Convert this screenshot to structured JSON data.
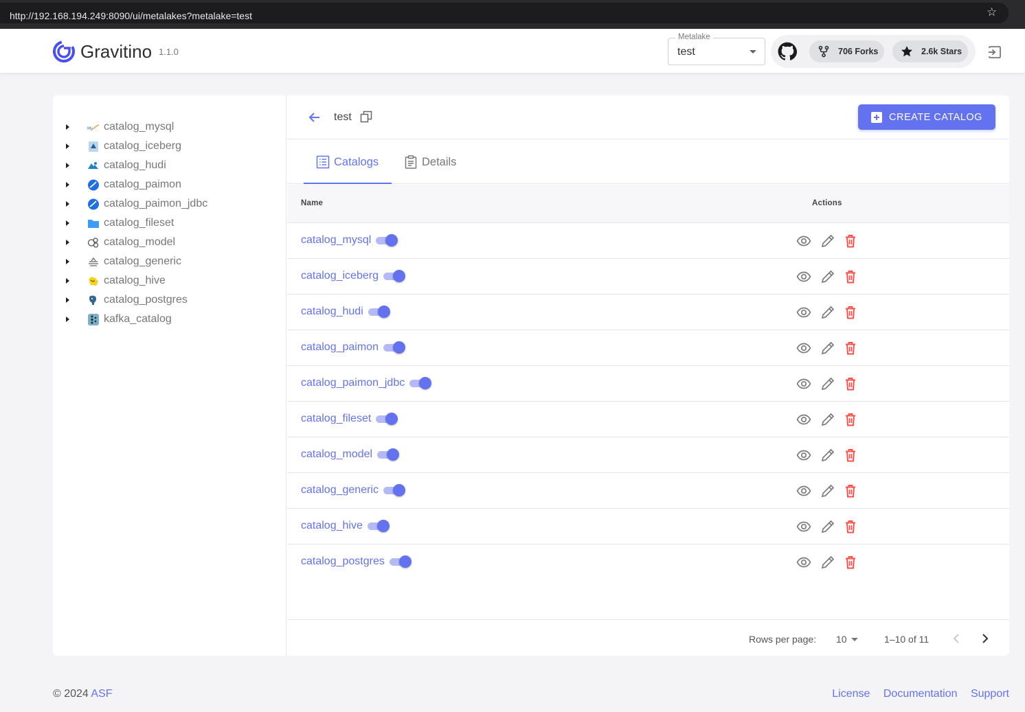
{
  "browser": {
    "url": "http://192.168.194.249:8090/ui/metalakes?metalake=test",
    "star_icon": "star-outline-icon"
  },
  "header": {
    "brand": "Gravitino",
    "version": "1.1.0",
    "metalake_select": {
      "label": "Metalake",
      "value": "test"
    },
    "github": {
      "forks": "706 Forks",
      "stars": "2.6k Stars"
    }
  },
  "tree": {
    "items": [
      {
        "label": "catalog_mysql",
        "icon": "mysql-icon"
      },
      {
        "label": "catalog_iceberg",
        "icon": "iceberg-icon"
      },
      {
        "label": "catalog_hudi",
        "icon": "hudi-icon"
      },
      {
        "label": "catalog_paimon",
        "icon": "paimon-icon"
      },
      {
        "label": "catalog_paimon_jdbc",
        "icon": "paimon-icon"
      },
      {
        "label": "catalog_fileset",
        "icon": "folder-icon"
      },
      {
        "label": "catalog_model",
        "icon": "model-icon"
      },
      {
        "label": "catalog_generic",
        "icon": "generic-icon"
      },
      {
        "label": "catalog_hive",
        "icon": "hive-icon"
      },
      {
        "label": "catalog_postgres",
        "icon": "postgres-icon"
      },
      {
        "label": "kafka_catalog",
        "icon": "kafka-icon"
      }
    ]
  },
  "content": {
    "metalake_name": "test",
    "create_button": "CREATE CATALOG",
    "tabs": [
      {
        "label": "Catalogs",
        "active": true
      },
      {
        "label": "Details",
        "active": false
      }
    ],
    "table": {
      "columns": [
        "Name",
        "Actions"
      ],
      "rows": [
        {
          "name": "catalog_mysql",
          "enabled": true
        },
        {
          "name": "catalog_iceberg",
          "enabled": true
        },
        {
          "name": "catalog_hudi",
          "enabled": true
        },
        {
          "name": "catalog_paimon",
          "enabled": true
        },
        {
          "name": "catalog_paimon_jdbc",
          "enabled": true
        },
        {
          "name": "catalog_fileset",
          "enabled": true
        },
        {
          "name": "catalog_model",
          "enabled": true
        },
        {
          "name": "catalog_generic",
          "enabled": true
        },
        {
          "name": "catalog_hive",
          "enabled": true
        },
        {
          "name": "catalog_postgres",
          "enabled": true
        }
      ]
    },
    "pagination": {
      "rows_per_page_label": "Rows per page:",
      "rows_per_page": "10",
      "range": "1–10 of 11"
    }
  },
  "footer": {
    "copyright": "© 2024",
    "org": "ASF",
    "links": [
      "License",
      "Documentation",
      "Support"
    ]
  },
  "colors": {
    "primary": "#6373ef",
    "danger": "#ff4d49"
  }
}
